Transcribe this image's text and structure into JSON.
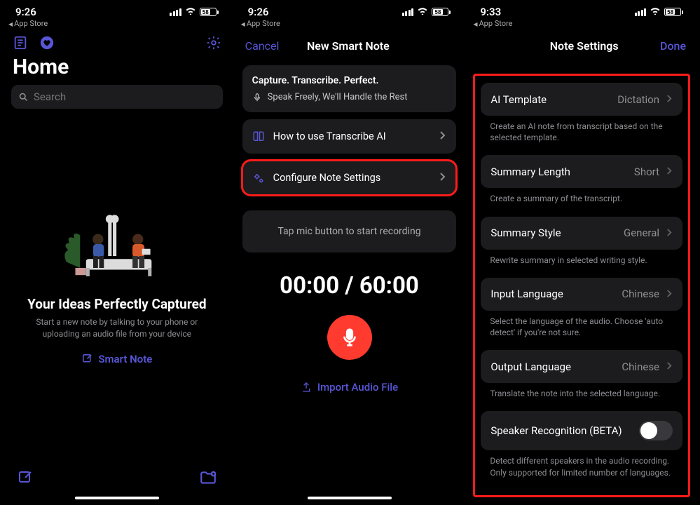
{
  "status": {
    "time1": "9:26",
    "time2": "9:26",
    "time3": "9:33",
    "back": "App Store",
    "battery": "58"
  },
  "s1": {
    "title": "Home",
    "search_placeholder": "Search",
    "hero_title": "Your Ideas Perfectly Captured",
    "hero_sub": "Start a new note by talking to your phone or uploading an audio file from your device",
    "smart_note": "Smart Note"
  },
  "s2": {
    "cancel": "Cancel",
    "title": "New Smart Note",
    "cap": "Capture. Transcribe. Perfect.",
    "sub": "Speak Freely, We'll Handle the Rest",
    "row_howto": "How to use Transcribe AI",
    "row_config": "Configure Note Settings",
    "tap_hint": "Tap mic button to start recording",
    "timer": "00:00 / 60:00",
    "import": "Import Audio File"
  },
  "s3": {
    "title": "Note Settings",
    "done": "Done",
    "items": [
      {
        "label": "AI Template",
        "value": "Dictation",
        "desc": "Create an AI note from transcript based on the selected template."
      },
      {
        "label": "Summary Length",
        "value": "Short",
        "desc": "Create a summary of the transcript."
      },
      {
        "label": "Summary Style",
        "value": "General",
        "desc": "Rewrite summary in selected writing style."
      },
      {
        "label": "Input Language",
        "value": "Chinese",
        "desc": "Select the language of the audio. Choose 'auto detect' if you're not sure."
      },
      {
        "label": "Output Language",
        "value": "Chinese",
        "desc": "Translate the note into the selected language."
      },
      {
        "label": "Speaker Recognition (BETA)",
        "value": "",
        "desc": "Detect different speakers in the audio recording. Only supported for limited number of languages."
      }
    ]
  }
}
